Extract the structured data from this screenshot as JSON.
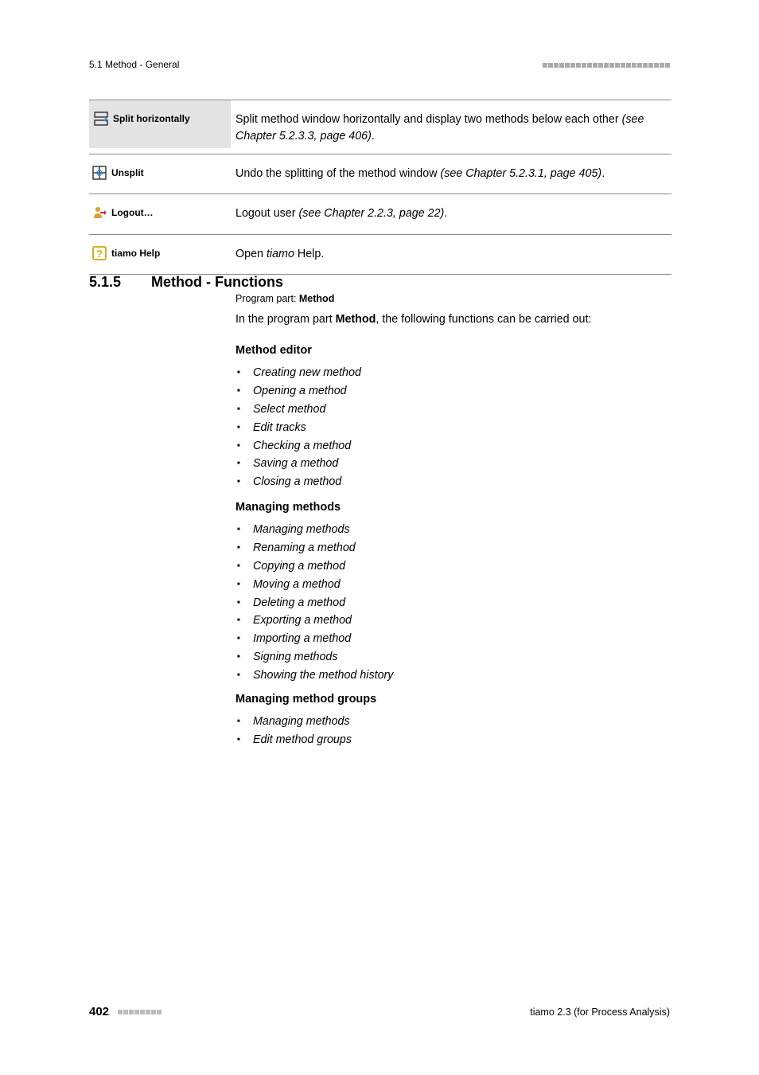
{
  "header": {
    "left": "5.1 Method - General"
  },
  "table": {
    "rows": [
      {
        "label": "Split horizontally",
        "icon": "split-horizontal",
        "desc_pre": "Split method window horizontally and display two methods below each other ",
        "desc_italic": "(see Chapter 5.2.3.3, page 406)",
        "desc_post": "."
      },
      {
        "label": "Unsplit",
        "icon": "unsplit",
        "desc_pre": "Undo the splitting of the method window ",
        "desc_italic": "(see Chapter 5.2.3.1, page 405)",
        "desc_post": "."
      },
      {
        "label": "Logout…",
        "icon": "logout",
        "desc_pre": "Logout user ",
        "desc_italic": "(see Chapter 2.2.3, page 22)",
        "desc_post": "."
      },
      {
        "label": "tiamo Help",
        "icon": "help",
        "desc_pre": "Open ",
        "desc_italic": "tiamo",
        "desc_post": " Help."
      }
    ]
  },
  "section": {
    "number": "5.1.5",
    "title": "Method - Functions",
    "program_part_label": "Program part: ",
    "program_part_value": "Method",
    "intro_pre": "In the program part ",
    "intro_bold": "Method",
    "intro_post": ", the following functions can be carried out:"
  },
  "sub1": {
    "heading": "Method editor",
    "items": [
      "Creating new method",
      "Opening a method",
      "Select method",
      "Edit tracks",
      "Checking a method",
      "Saving a method",
      "Closing a method"
    ]
  },
  "sub2": {
    "heading": "Managing methods",
    "items": [
      "Managing methods",
      "Renaming a method",
      "Copying a method",
      "Moving a method",
      "Deleting a method",
      "Exporting a method",
      "Importing a method",
      "Signing methods",
      "Showing the method history"
    ]
  },
  "sub3": {
    "heading": "Managing method groups",
    "items": [
      "Managing methods",
      "Edit method groups"
    ]
  },
  "footer": {
    "page": "402",
    "right": "tiamo 2.3 (for Process Analysis)"
  }
}
